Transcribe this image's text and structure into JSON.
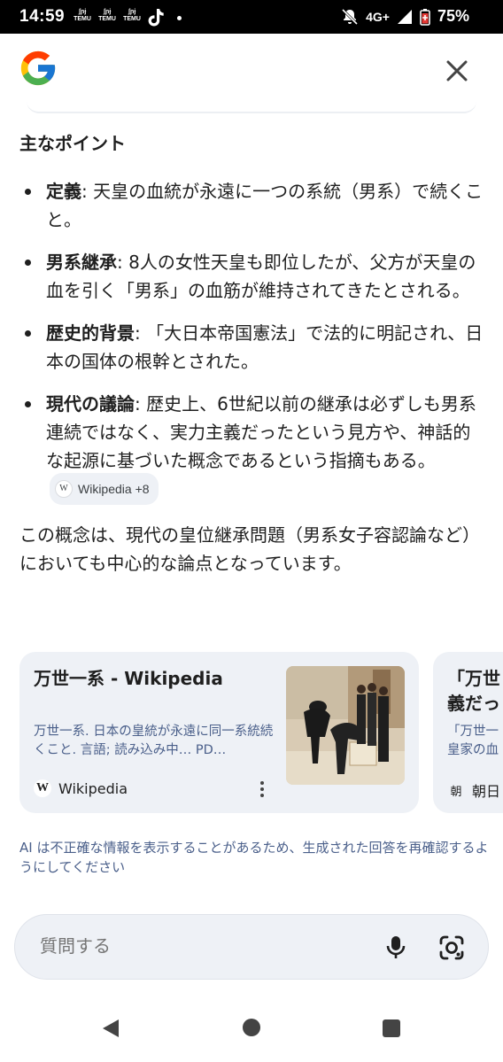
{
  "status_bar": {
    "time": "14:59",
    "apps": [
      "TEMU",
      "TEMU",
      "TEMU"
    ],
    "network": "4G+",
    "battery": "75%"
  },
  "answer": {
    "heading": "主なポイント",
    "points": [
      {
        "term": "定義",
        "text": ": 天皇の血統が永遠に一つの系統（男系）で続くこと。"
      },
      {
        "term": "男系継承",
        "text": ": 8人の女性天皇も即位したが、父方が天皇の血を引く「男系」の血筋が維持されてきたとされる。"
      },
      {
        "term": "歴史的背景",
        "text": ": 「大日本帝国憲法」で法的に明記され、日本の国体の根幹とされた。"
      },
      {
        "term": "現代の議論",
        "text": ": 歴史上、6世紀以前の継承は必ずしも男系連続ではなく、実力主義だったという見方や、神話的な起源に基づいた概念であるという指摘もある。"
      }
    ],
    "source_chip": "Wikipedia +8",
    "summary": "この概念は、現代の皇位継承問題（男系女子容認論など）においても中心的な論点となっています。"
  },
  "cards": [
    {
      "title": "万世一系 - Wikipedia",
      "snippet": "万世一系. 日本の皇統が永遠に同一系統続くこと. 言語; 読み込み中… PD…",
      "source": "Wikipedia"
    },
    {
      "title": "「万世\n義だっ",
      "snippet": "「万世一\n皇家の血",
      "source": "朝日"
    }
  ],
  "disclaimer": "AI は不正確な情報を表示することがあるため、生成された回答を再確認するようにしてください",
  "ask_bar": {
    "placeholder": "質問する"
  },
  "colors": {
    "card_bg": "#eef1f6",
    "snippet_text": "#4a5f8a"
  }
}
